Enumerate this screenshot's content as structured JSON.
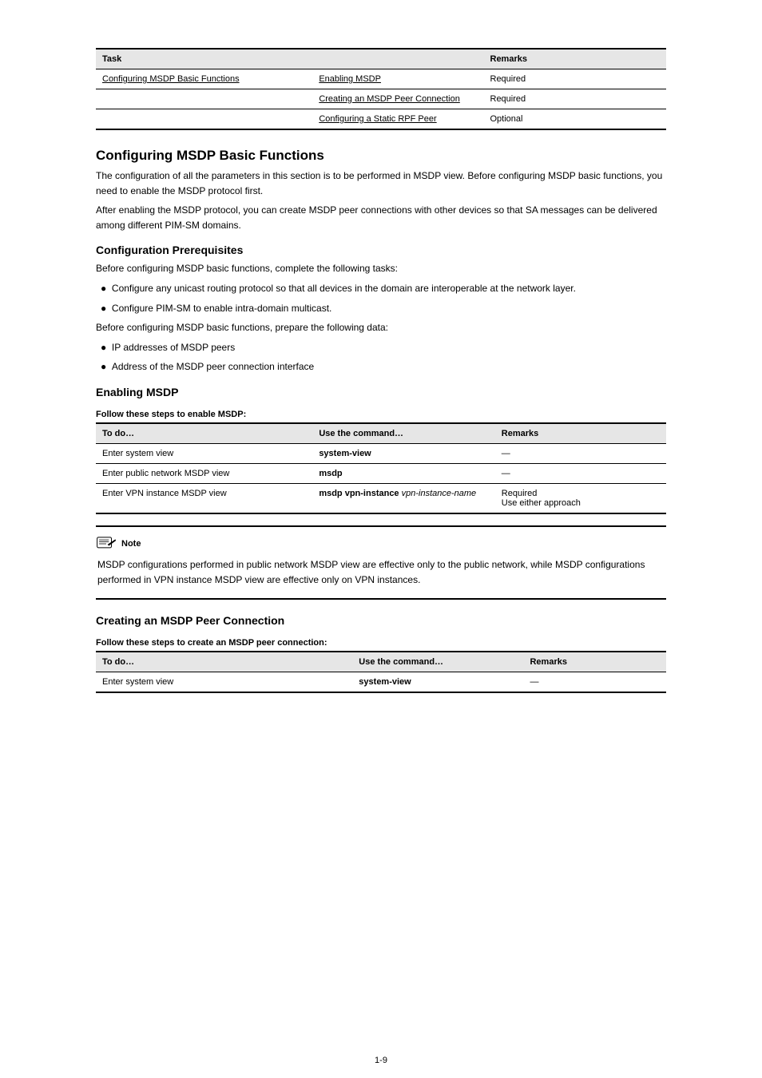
{
  "section_title": "Configuring MSDP Basic Functions",
  "intro_a": "The configuration of all the parameters in this section is to be performed in MSDP view. Before configuring MSDP basic functions, you need to enable the MSDP protocol first.",
  "intro_b": "After enabling the MSDP protocol, you can create MSDP peer connections with other devices so that SA messages can be delivered among different PIM-SM domains.",
  "h1": "Configuration Prerequisites",
  "p1": "Before configuring MSDP basic functions, complete the following tasks:",
  "bul1": "Configure any unicast routing protocol so that all devices in the domain are interoperable at the network layer.",
  "bul2": "Configure PIM-SM to enable intra-domain multicast.",
  "p2": "Before configuring MSDP basic functions, prepare the following data:",
  "bul3": "IP addresses of MSDP peers",
  "bul4": "Address of the MSDP peer connection interface",
  "h2": "Enabling MSDP",
  "cap1": "Follow these steps to enable MSDP:",
  "table1": {
    "head": [
      "To do…",
      "Use the command…",
      "Remarks"
    ],
    "rows": [
      [
        "Enter system view",
        {
          "bold": "system-view"
        },
        "—"
      ],
      [
        "Enter public network MSDP view",
        {
          "bold": "msdp"
        },
        "—"
      ],
      [
        "Enter VPN instance MSDP view",
        {
          "parts": [
            {
              "t": "msdp vpn-instance ",
              "b": true
            },
            {
              "t": "vpn-instance-name",
              "b": false
            }
          ]
        },
        "Required"
      ]
    ]
  },
  "note_text": "MSDP configurations performed in public network MSDP view are effective only to the public network, while MSDP configurations performed in VPN instance MSDP view are effective only on VPN instances.",
  "h3": "Creating an MSDP Peer Connection",
  "cap2": "Follow these steps to create an MSDP peer connection:",
  "table2": {
    "head": [
      "To do…",
      "Use the command…",
      "Remarks"
    ],
    "rows": [
      [
        "Enter system view",
        {
          "bold": "system-view"
        },
        "—"
      ]
    ]
  },
  "pagenum": "1-9",
  "section_link": "Configuring MSDP Basic Functions",
  "table0": {
    "head": [
      "Task",
      "Remarks"
    ],
    "rows": [
      [
        "Enabling MSDP",
        "Required"
      ],
      [
        "Creating an MSDP Peer Connection",
        "Required"
      ],
      [
        "Configuring a Static RPF Peer",
        "Optional"
      ]
    ]
  }
}
